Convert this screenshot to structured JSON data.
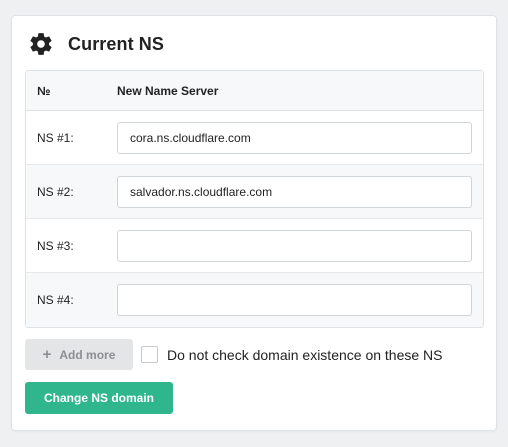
{
  "panel": {
    "title": "Current NS",
    "icon": "gear-icon"
  },
  "table": {
    "headers": {
      "number": "№",
      "server": "New Name Server"
    },
    "rows": [
      {
        "label": "NS #1:",
        "value": "cora.ns.cloudflare.com"
      },
      {
        "label": "NS #2:",
        "value": "salvador.ns.cloudflare.com"
      },
      {
        "label": "NS #3:",
        "value": ""
      },
      {
        "label": "NS #4:",
        "value": ""
      }
    ]
  },
  "controls": {
    "add_more_label": "Add more",
    "add_more_icon": "plus-icon",
    "checkbox_label": "Do not check domain existence on these NS",
    "checkbox_checked": false
  },
  "submit": {
    "label": "Change NS domain"
  },
  "colors": {
    "accent": "#2fb68d",
    "background": "#eef0f2",
    "disabled_button": "#e3e5e7"
  }
}
